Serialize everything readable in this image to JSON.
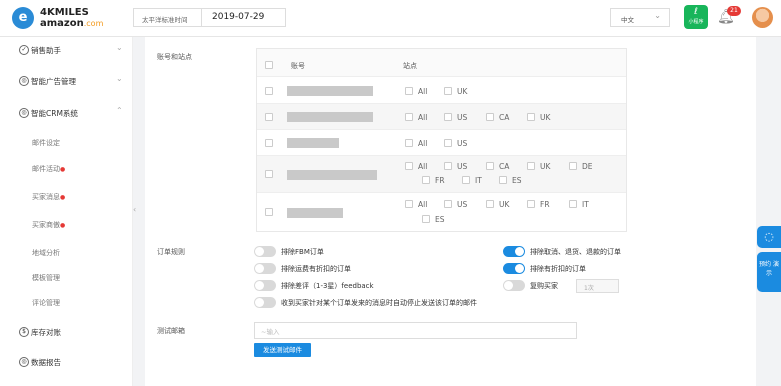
{
  "brand": {
    "mark": "e",
    "line1": "4KMILES",
    "line2": "amazon",
    "line2_suffix": ".com"
  },
  "header": {
    "timezone_label": "太平洋标准时间",
    "date": "2019-07-29",
    "language": "中文",
    "language_arrow": "⌄",
    "mini_app_icon": "ℓ",
    "mini_app_label": "小程序",
    "notification_count": "21"
  },
  "sidebar": {
    "items": [
      {
        "label": "销售助手",
        "icon": "✓"
      },
      {
        "label": "智能广告管理",
        "icon": "◎"
      },
      {
        "label": "智能CRM系统",
        "icon": "◎"
      }
    ],
    "sub_items": [
      {
        "label": "邮件设定",
        "dot": ""
      },
      {
        "label": "邮件活动",
        "dot": "●"
      },
      {
        "label": "买家消息",
        "dot": "●"
      },
      {
        "label": "买家商傲",
        "dot": "●"
      },
      {
        "label": "地域分析",
        "dot": ""
      },
      {
        "label": "模板管理",
        "dot": ""
      },
      {
        "label": "评论管理",
        "dot": ""
      }
    ],
    "bottom_items": [
      {
        "label": "库存对账",
        "icon": "$"
      },
      {
        "label": "数据报告",
        "icon": "◎"
      }
    ],
    "chevron": "⌄",
    "collapse": "‹"
  },
  "account_section": {
    "label": "账号和站点",
    "col_account": "账号",
    "col_site": "站点",
    "rows": [
      {
        "sites": [
          "All",
          "UK"
        ]
      },
      {
        "sites": [
          "All",
          "US",
          "CA",
          "UK"
        ]
      },
      {
        "sites": [
          "All",
          "US"
        ]
      },
      {
        "sites": [
          "All",
          "US",
          "CA",
          "UK",
          "DE"
        ],
        "sites2": [
          "FR",
          "IT",
          "ES"
        ]
      },
      {
        "sites": [
          "All",
          "US",
          "UK",
          "FR",
          "IT"
        ],
        "sites2": [
          "ES"
        ]
      }
    ]
  },
  "order_rules": {
    "label": "订单规则",
    "options": [
      {
        "text": "排除FBM订单",
        "on": false
      },
      {
        "text": "排除取消、退货、退款的订单",
        "on": true
      },
      {
        "text": "排除运费有折扣的订单",
        "on": false
      },
      {
        "text": "排除有折扣的订单",
        "on": true
      },
      {
        "text": "排除差评（1-3星）feedback",
        "on": false
      },
      {
        "text": "复购买家",
        "on": false
      },
      {
        "text": "收到买家针对某个订单发来的消息时自动停止发送该订单的邮件",
        "on": false
      }
    ],
    "repeat_buyer_select": "1次"
  },
  "test_email": {
    "label": "测试邮箱",
    "placeholder": "~输入",
    "send_button": "发送测试邮件"
  },
  "float": {
    "icon1": "◌",
    "label2": "预约 演示"
  },
  "colors": {
    "accent": "#1b8be0",
    "toggle_off": "#d9d9d9",
    "badge": "#e53935",
    "mini_app": "#18b55a"
  }
}
